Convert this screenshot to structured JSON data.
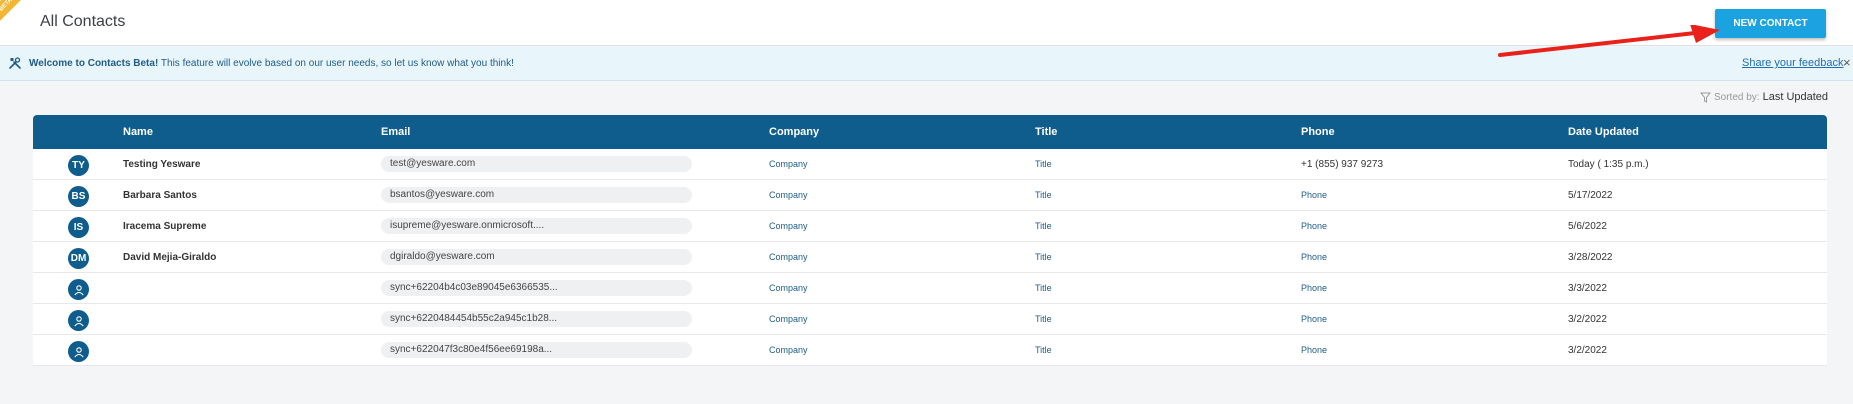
{
  "header": {
    "title": "All Contacts",
    "new_contact_label": "NEW CONTACT",
    "ribbon": "BETA"
  },
  "banner": {
    "bold": "Welcome to Contacts Beta!",
    "text": " This feature will evolve based on our user needs, so let us know what you think!",
    "feedback": "Share your feedback",
    "close": "×"
  },
  "sort": {
    "label": "Sorted by:",
    "value": "Last Updated"
  },
  "table": {
    "columns": [
      "Name",
      "Email",
      "Company",
      "Title",
      "Phone",
      "Date Updated"
    ],
    "rows": [
      {
        "initials": "TY",
        "name": "Testing Yesware",
        "email": "test@yesware.com",
        "company": "Company",
        "title": "Title",
        "phone": "+1 (855) 937 9273",
        "date": "Today ( 1:35 p.m.)"
      },
      {
        "initials": "BS",
        "name": "Barbara Santos",
        "email": "bsantos@yesware.com",
        "company": "Company",
        "title": "Title",
        "phone": "Phone",
        "date": "5/17/2022"
      },
      {
        "initials": "IS",
        "name": "Iracema Supreme",
        "email": "isupreme@yesware.onmicrosoft....",
        "company": "Company",
        "title": "Title",
        "phone": "Phone",
        "date": "5/6/2022"
      },
      {
        "initials": "DM",
        "name": "David Mejia-Giraldo",
        "email": "dgiraldo@yesware.com",
        "company": "Company",
        "title": "Title",
        "phone": "Phone",
        "date": "3/28/2022"
      },
      {
        "initials": "",
        "name": "",
        "email": "sync+62204b4c03e89045e6366535...",
        "company": "Company",
        "title": "Title",
        "phone": "Phone",
        "date": "3/3/2022"
      },
      {
        "initials": "",
        "name": "",
        "email": "sync+6220484454b55c2a945c1b28...",
        "company": "Company",
        "title": "Title",
        "phone": "Phone",
        "date": "3/2/2022"
      },
      {
        "initials": "",
        "name": "",
        "email": "sync+622047f3c80e4f56ee69198a...",
        "company": "Company",
        "title": "Title",
        "phone": "Phone",
        "date": "3/2/2022"
      }
    ]
  },
  "colors": {
    "header_bg": "#0f5d8d",
    "button": "#1aa3e0",
    "banner_bg": "#e8f5fb",
    "arrow": "#e8211b"
  }
}
